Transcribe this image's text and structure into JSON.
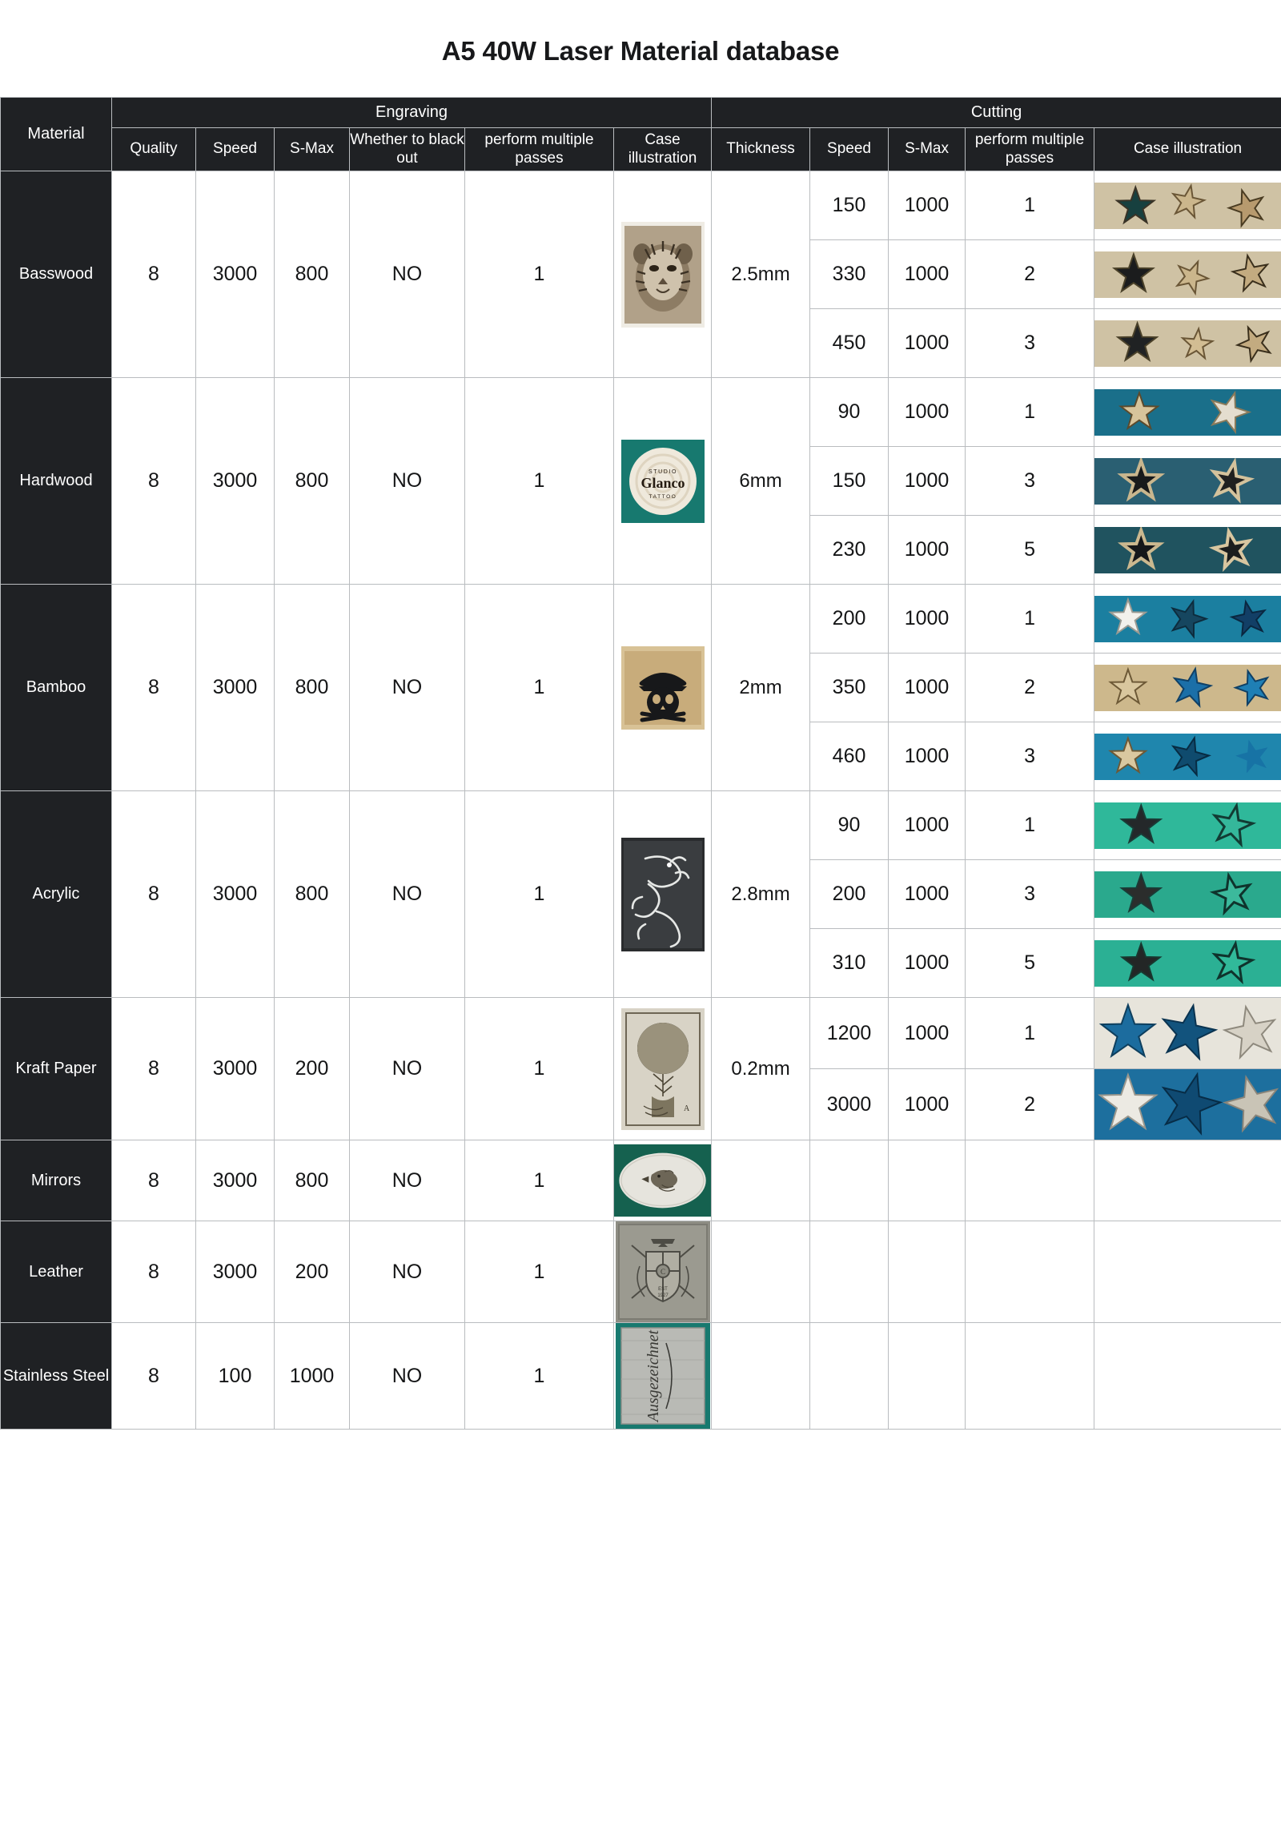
{
  "page": {
    "title": "A5 40W Laser Material database"
  },
  "header": {
    "material": "Material",
    "groups": {
      "engraving": "Engraving",
      "cutting": "Cutting"
    },
    "engraving_cols": [
      "Quality",
      "Speed",
      "S-Max",
      "Whether to black out",
      "perform multiple passes",
      "Case illustration"
    ],
    "cutting_cols": [
      "Thickness",
      "Speed",
      "S-Max",
      "perform multiple passes",
      "Case illustration"
    ]
  },
  "colors": {
    "header_bg": "#1f2124",
    "header_text": "#ffffff",
    "grid": "#b9bcbf",
    "body_text": "#141516",
    "teal": "#17796f",
    "teal_dark": "#0f5f58",
    "acrylic_teal": "#2fb89a",
    "wood_light": "#d8c7a4",
    "wood_mid": "#b79a6e",
    "steel": "#b9bab5",
    "blue": "#1b6fa8",
    "blue_dark": "#123f66"
  },
  "rows": [
    {
      "material": "Basswood",
      "engraving": {
        "quality": "8",
        "speed": "3000",
        "smax": "800",
        "blackout": "NO",
        "passes": "1"
      },
      "case": {
        "kind": "tiger-engraving",
        "caption": "tiger head engraved on wood panel"
      },
      "thickness": "2.5mm",
      "cutting": [
        {
          "speed": "150",
          "smax": "1000",
          "passes": "1",
          "art": "basswood-stars-1"
        },
        {
          "speed": "330",
          "smax": "1000",
          "passes": "2",
          "art": "basswood-stars-2"
        },
        {
          "speed": "450",
          "smax": "1000",
          "passes": "3",
          "art": "basswood-stars-3"
        }
      ]
    },
    {
      "material": "Hardwood",
      "engraving": {
        "quality": "8",
        "speed": "3000",
        "smax": "800",
        "blackout": "NO",
        "passes": "1"
      },
      "case": {
        "kind": "glanco-logo",
        "caption": "STUDIO Glanco TATTOO wood slice",
        "line1": "STUDIO",
        "line2": "Glanco",
        "line3": "TATTOO"
      },
      "thickness": "6mm",
      "cutting": [
        {
          "speed": "90",
          "smax": "1000",
          "passes": "1",
          "art": "hardwood-stars-1"
        },
        {
          "speed": "150",
          "smax": "1000",
          "passes": "3",
          "art": "hardwood-stars-2"
        },
        {
          "speed": "230",
          "smax": "1000",
          "passes": "5",
          "art": "hardwood-stars-3"
        }
      ]
    },
    {
      "material": "Bamboo",
      "engraving": {
        "quality": "8",
        "speed": "3000",
        "smax": "800",
        "blackout": "NO",
        "passes": "1"
      },
      "case": {
        "kind": "skull-engraving",
        "caption": "pirate skull engraved on bamboo board"
      },
      "thickness": "2mm",
      "cutting": [
        {
          "speed": "200",
          "smax": "1000",
          "passes": "1",
          "art": "bamboo-stars-1"
        },
        {
          "speed": "350",
          "smax": "1000",
          "passes": "2",
          "art": "bamboo-stars-2"
        },
        {
          "speed": "460",
          "smax": "1000",
          "passes": "3",
          "art": "bamboo-stars-3"
        }
      ]
    },
    {
      "material": "Acrylic",
      "engraving": {
        "quality": "8",
        "speed": "3000",
        "smax": "800",
        "blackout": "NO",
        "passes": "1"
      },
      "case": {
        "kind": "dragon-engraving",
        "caption": "dragon engraved on dark acrylic"
      },
      "thickness": "2.8mm",
      "cutting": [
        {
          "speed": "90",
          "smax": "1000",
          "passes": "1",
          "art": "acrylic-stars-1"
        },
        {
          "speed": "200",
          "smax": "1000",
          "passes": "3",
          "art": "acrylic-stars-2"
        },
        {
          "speed": "310",
          "smax": "1000",
          "passes": "5",
          "art": "acrylic-stars-3"
        }
      ]
    },
    {
      "material": "Kraft Paper",
      "engraving": {
        "quality": "8",
        "speed": "3000",
        "smax": "200",
        "blackout": "NO",
        "passes": "1"
      },
      "case": {
        "kind": "tree-engraving",
        "caption": "tree of life engraved on kraft paper"
      },
      "thickness": "0.2mm",
      "cutting": [
        {
          "speed": "1200",
          "smax": "1000",
          "passes": "1",
          "art": "kraft-stars-1"
        },
        {
          "speed": "3000",
          "smax": "1000",
          "passes": "2",
          "art": "kraft-stars-2"
        }
      ]
    },
    {
      "material": "Mirrors",
      "engraving": {
        "quality": "8",
        "speed": "3000",
        "smax": "800",
        "blackout": "NO",
        "passes": "1"
      },
      "case": {
        "kind": "eagle-engraving",
        "caption": "eagle head engraved on oval mirror"
      },
      "thickness": "",
      "cutting": []
    },
    {
      "material": "Leather",
      "engraving": {
        "quality": "8",
        "speed": "3000",
        "smax": "200",
        "blackout": "NO",
        "passes": "1"
      },
      "case": {
        "kind": "crest-engraving",
        "caption": "heraldic crest engraved on leather"
      },
      "thickness": "",
      "cutting": []
    },
    {
      "material": "Stainless Steel",
      "engraving": {
        "quality": "8",
        "speed": "100",
        "smax": "1000",
        "blackout": "NO",
        "passes": "1"
      },
      "case": {
        "kind": "steel-engraving",
        "caption": "script lettering engraved on steel plate"
      },
      "thickness": "",
      "cutting": []
    }
  ]
}
